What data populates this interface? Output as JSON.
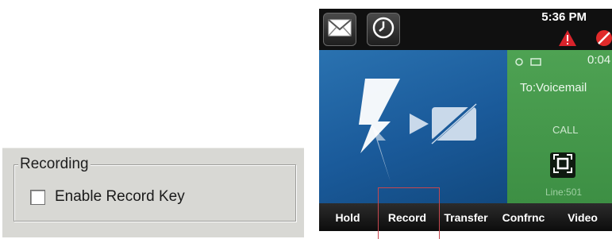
{
  "settings_panel": {
    "group_title": "Recording",
    "checkbox_label": "Enable Record Key",
    "checkbox_checked": false
  },
  "phone": {
    "status_bar": {
      "time": "5:36 PM",
      "icons": [
        "envelope-icon",
        "clock-icon",
        "warning-icon",
        "no-call-icon"
      ]
    },
    "call": {
      "duration": "0:04",
      "to": "To:Voicemail",
      "state": "CALL",
      "line": "Line:501"
    },
    "softkeys": [
      "Hold",
      "Record",
      "Transfer",
      "Confrnc",
      "Video"
    ],
    "colors": {
      "blue_panel": "#1a5a9a",
      "green_panel": "#43964a",
      "highlight_box": "#c7474f",
      "warning": "#d9232b"
    }
  }
}
